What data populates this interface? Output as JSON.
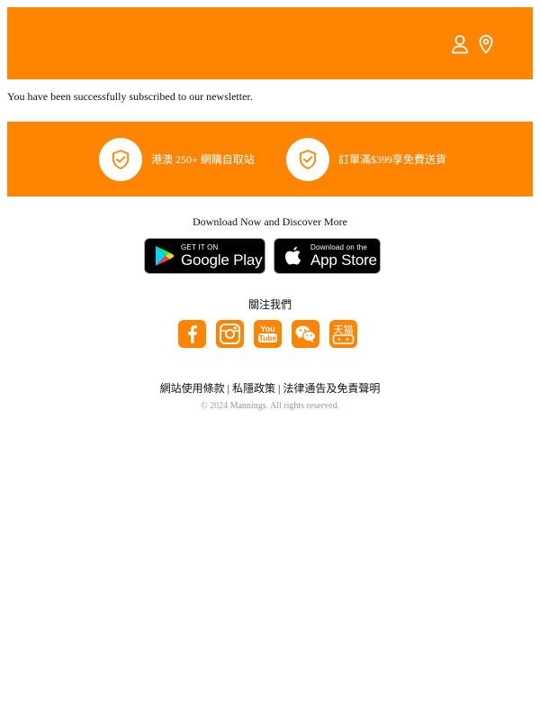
{
  "header": {
    "account_icon": "user-icon",
    "location_icon": "map-pin-icon",
    "background_color": "#ff8400"
  },
  "notice": {
    "message": "You have been successfully subscribed to our newsletter."
  },
  "features": {
    "items": [
      {
        "icon": "shield-check-icon",
        "label": "港澳 250+ 網購自取站"
      },
      {
        "icon": "shield-check-icon",
        "label": "訂單滿$399享免費送貨"
      }
    ]
  },
  "download": {
    "title": "Download Now and Discover More",
    "google_play": {
      "small": "GET IT ON",
      "big": "Google Play"
    },
    "app_store": {
      "small": "Download on the",
      "big": "App Store"
    }
  },
  "follow": {
    "title": "關注我們",
    "networks": [
      {
        "name": "facebook",
        "icon": "facebook-icon"
      },
      {
        "name": "instagram",
        "icon": "instagram-icon"
      },
      {
        "name": "youtube",
        "icon": "youtube-icon",
        "top": "You",
        "bottom": "Tube"
      },
      {
        "name": "wechat",
        "icon": "wechat-icon"
      },
      {
        "name": "tmall",
        "icon": "tmall-icon",
        "label": "天猫"
      }
    ]
  },
  "footer": {
    "links": [
      {
        "label": "網站使用條款"
      },
      {
        "label": "私隱政策"
      },
      {
        "label": "法律通告及免責聲明"
      }
    ],
    "separator": " | ",
    "copyright": "© 2024 Mannings. All rights reserved."
  },
  "colors": {
    "brand_orange": "#ff8400",
    "copyright_gray": "#999999"
  }
}
